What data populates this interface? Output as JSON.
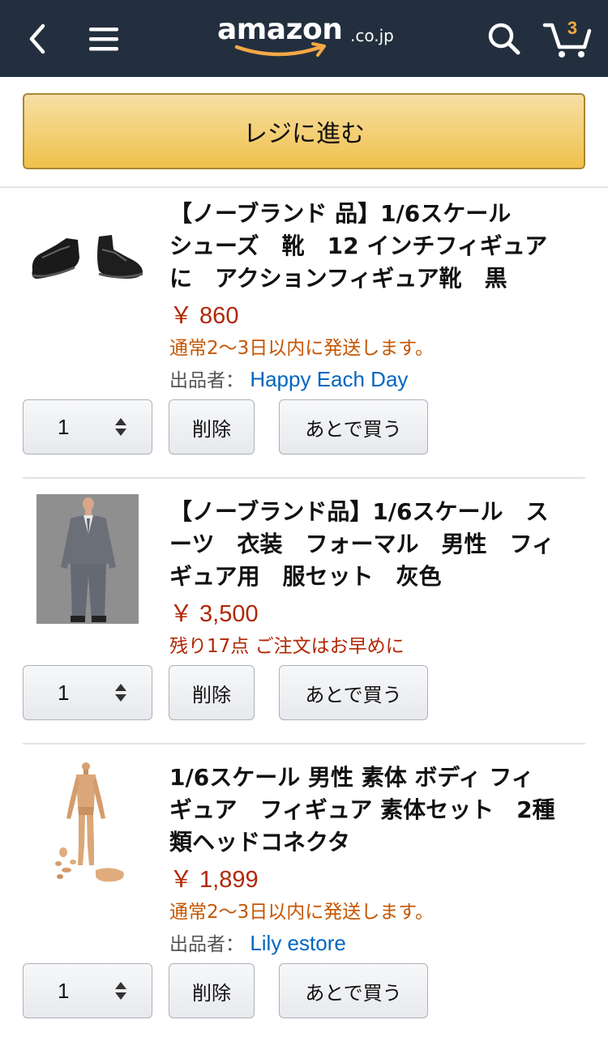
{
  "header": {
    "logo_word": "amazon",
    "logo_domain": ".co.jp",
    "cart_count": "3",
    "icons": [
      "back-arrow-icon",
      "hamburger-menu-icon",
      "search-icon",
      "cart-icon"
    ],
    "colors": {
      "bar": "#232f3e",
      "accent": "#f3a847"
    }
  },
  "checkout": {
    "label": "レジに進む"
  },
  "items": [
    {
      "title_lines": [
        "【ノーブランド 品】1/6スケール",
        "シューズ　靴　12 インチフィギュア",
        "に　アクションフィギュア靴　黒"
      ],
      "price": "￥ 860",
      "availability": "通常2〜3日以内に発送します。",
      "seller_label": "出品者：",
      "seller_name": "Happy Each Day",
      "quantity": "1",
      "delete_label": "削除",
      "save_later_label": "あとで買う"
    },
    {
      "title_lines": [
        "【ノーブランド品】1/6スケール　ス",
        "ーツ　衣装　フォーマル　男性　フィ",
        "ギュア用　服セット　灰色"
      ],
      "price": "￥ 3,500",
      "availability": "残り17点 ご注文はお早めに",
      "quantity": "1",
      "delete_label": "削除",
      "save_later_label": "あとで買う"
    },
    {
      "title_lines": [
        "1/6スケール 男性 素体 ボディ フィ",
        "ギュア　フィギュア 素体セット　2種",
        "類ヘッドコネクタ"
      ],
      "price": "￥ 1,899",
      "availability": "通常2〜3日以内に発送します。",
      "seller_label": "出品者：",
      "seller_name": "Lily estore",
      "quantity": "1",
      "delete_label": "削除",
      "save_later_label": "あとで買う"
    }
  ],
  "colors": {
    "price": "#b12704",
    "shipping": "#c45500",
    "link": "#0066c0",
    "checkout": "#f0c14b"
  }
}
